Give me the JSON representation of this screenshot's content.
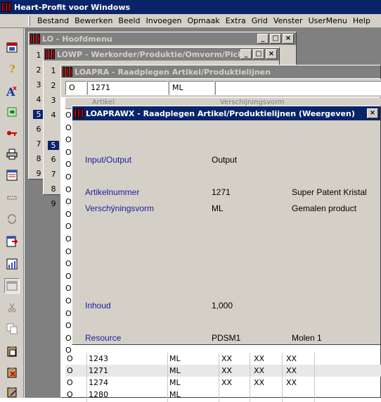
{
  "app": {
    "title": "Heart-Profit voor Windows"
  },
  "menubar": [
    "Bestand",
    "Bewerken",
    "Beeld",
    "Invoegen",
    "Opmaak",
    "Extra",
    "Grid",
    "Venster",
    "UserMenu",
    "Help"
  ],
  "toolbar": {
    "icons": [
      "calendar-icon",
      "help-icon",
      "font-delete-icon",
      "document-transfer-icon",
      "key-icon",
      "printer-icon",
      "form-icon",
      "dotted-box-icon",
      "refresh-icon",
      "export-icon",
      "report-chart-icon",
      "window-icon",
      "scissors-icon",
      "copy-icon",
      "clipboard-icon",
      "clipboard-delete-icon",
      "clipboard-edit-icon"
    ]
  },
  "windows": {
    "hoofdmenu": {
      "title": "LO - Hoofdmenu",
      "numbers": [
        "1",
        "2",
        "3",
        "4",
        "5",
        "6",
        "7",
        "8",
        "9"
      ],
      "selected": "5"
    },
    "werkorder": {
      "title": "LOWP - Werkorder/Produktie/Omvorm/Pick...",
      "numbers": [
        "1",
        "2",
        "3",
        "4",
        "5",
        "6",
        "7",
        "8",
        "9"
      ],
      "selected": "5"
    },
    "raadplegen": {
      "title": "LOAPRA - Raadplegen Artikel/Produktielijnen",
      "filter": {
        "io": "O",
        "artikel": "1271",
        "vorm": "ML"
      },
      "partial_header": [
        "Artikel",
        "Verschijningsvorm"
      ],
      "rows": [
        {
          "io": "O",
          "artikel": "1243",
          "vorm": "ML",
          "c1": "XX",
          "c2": "XX",
          "c3": "XX"
        },
        {
          "io": "O",
          "artikel": "1271",
          "vorm": "ML",
          "c1": "XX",
          "c2": "XX",
          "c3": "XX"
        },
        {
          "io": "O",
          "artikel": "1274",
          "vorm": "ML",
          "c1": "XX",
          "c2": "XX",
          "c3": "XX"
        },
        {
          "io": "O",
          "artikel": "1280",
          "vorm": "ML",
          "c1": "",
          "c2": "",
          "c3": ""
        }
      ],
      "left_o": "O"
    },
    "dialog": {
      "title": "LOAPRAWX - Raadplegen Artikel/Produktielijnen (Weergeven)",
      "fields": {
        "io_label": "Input/Output",
        "io_value": "Output",
        "art_label": "Artikelnummer",
        "art_value": "1271",
        "art_desc": "Super Patent Kristal",
        "vorm_label": "Verschÿningsvorm",
        "vorm_value": "ML",
        "vorm_desc": "Gemalen product",
        "inhoud_label": "Inhoud",
        "inhoud_value": "1,000",
        "res_label": "Resource",
        "res_value": "PDSM1",
        "res_desc": "Molen 1"
      }
    }
  }
}
